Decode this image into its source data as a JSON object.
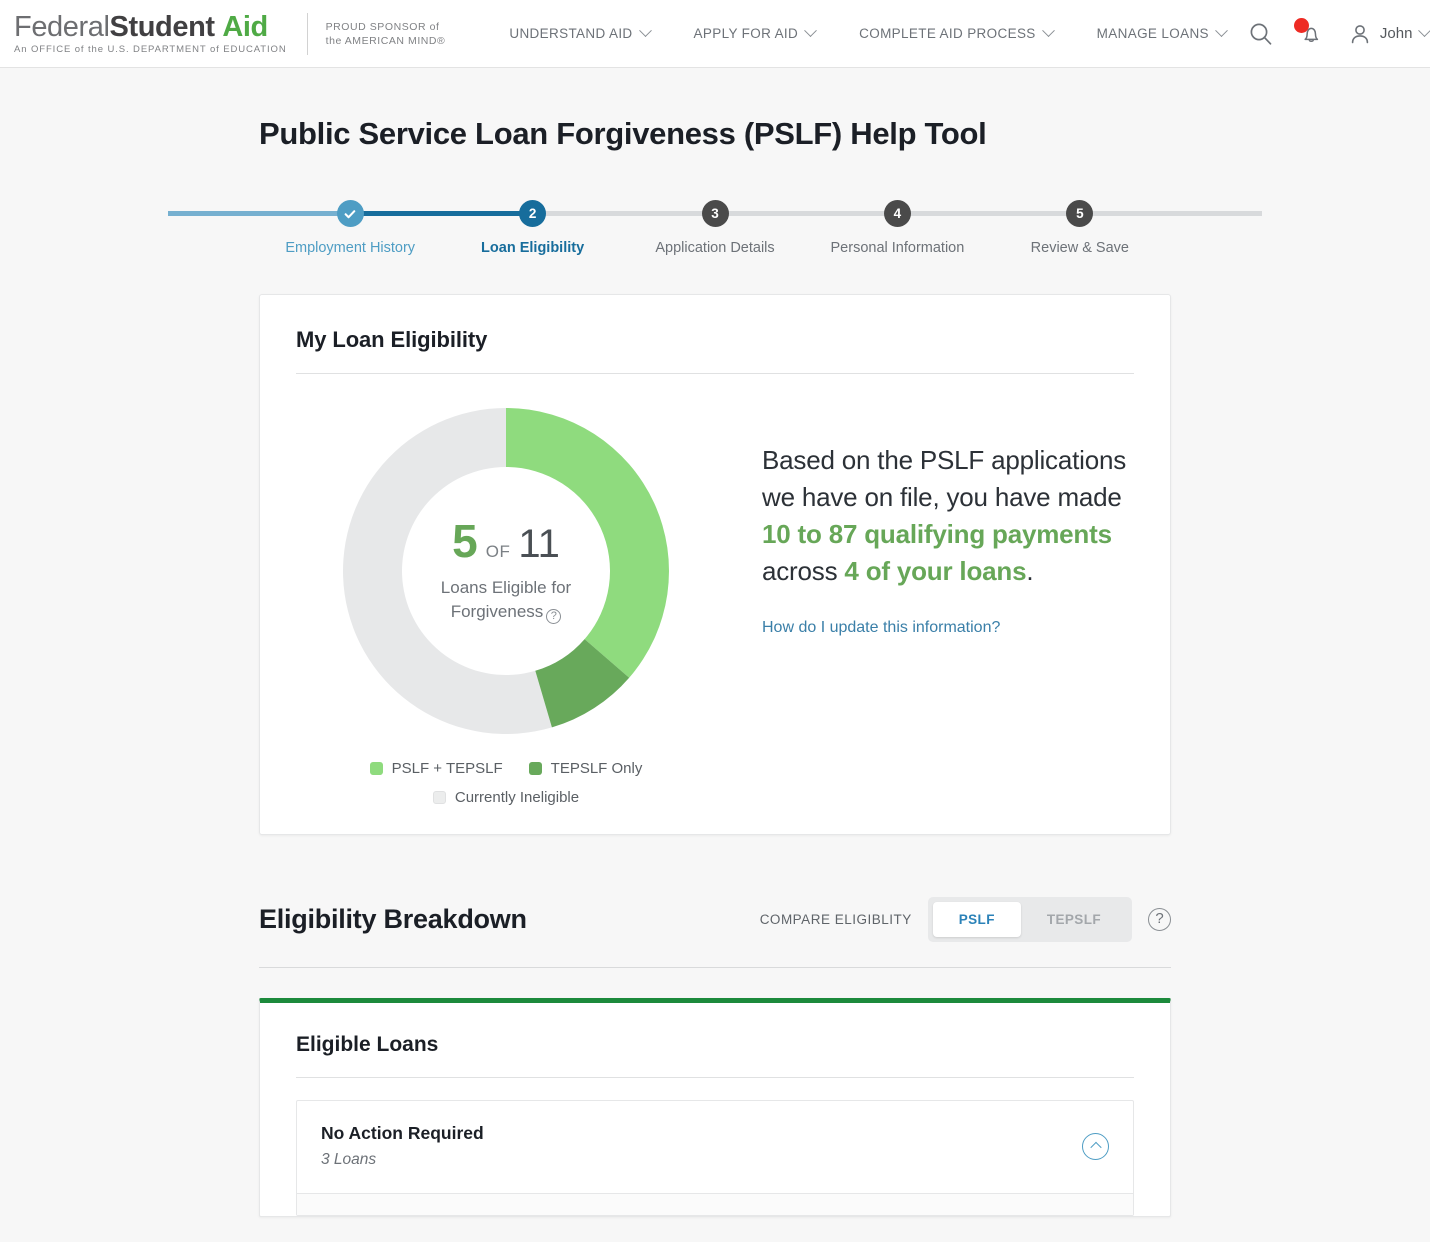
{
  "brand": {
    "line1_part1": "Federal",
    "line1_part2": "Student",
    "line1_part3": "Aid",
    "line2": "An OFFICE of the U.S. DEPARTMENT of EDUCATION",
    "tagline_line1": "PROUD SPONSOR of",
    "tagline_line2": "the AMERICAN MIND®"
  },
  "nav": {
    "items": [
      {
        "label": "UNDERSTAND AID"
      },
      {
        "label": "APPLY FOR AID"
      },
      {
        "label": "COMPLETE AID PROCESS"
      },
      {
        "label": "MANAGE LOANS"
      }
    ],
    "search_icon": "search-icon",
    "notification_icon": "bell-icon",
    "has_notification": true,
    "user_name": "John"
  },
  "page": {
    "title": "Public Service Loan Forgiveness (PSLF) Help Tool"
  },
  "stepper": {
    "steps": [
      {
        "num": "✓",
        "label": "Employment History",
        "state": "done"
      },
      {
        "num": "2",
        "label": "Loan Eligibility",
        "state": "current"
      },
      {
        "num": "3",
        "label": "Application Details",
        "state": "todo"
      },
      {
        "num": "4",
        "label": "Personal Information",
        "state": "todo"
      },
      {
        "num": "5",
        "label": "Review & Save",
        "state": "todo"
      }
    ]
  },
  "eligibility_card": {
    "title": "My Loan Eligibility",
    "center": {
      "numerator": "5",
      "of": "OF",
      "denominator": "11",
      "caption": "Loans Eligible for Forgiveness",
      "help_icon": "question-mark-icon"
    },
    "legend": [
      {
        "label": "PSLF + TEPSLF",
        "color": "#8fdb7e"
      },
      {
        "label": "TEPSLF Only",
        "color": "#68a95b"
      },
      {
        "label": "Currently Ineligible",
        "color": "#e7e8e9"
      }
    ],
    "statement": {
      "p1": "Based on the PSLF applications we have on file, you have made ",
      "h1": "10 to 87 qualifying payments",
      "p2": " across ",
      "h2": "4 of your loans",
      "p3": "."
    },
    "link": "How do I update this information?"
  },
  "chart_data": {
    "type": "pie",
    "title": "Loans Eligible for Forgiveness",
    "subtitle": "5 OF 11",
    "categories": [
      "PSLF + TEPSLF",
      "TEPSLF Only",
      "Currently Ineligible"
    ],
    "values": [
      4,
      1,
      6
    ],
    "colors": [
      "#8fdb7e",
      "#68a95b",
      "#e7e8e9"
    ],
    "total": 11,
    "eligible_total": 5,
    "unit": "loans",
    "legend_position": "bottom",
    "donut": true,
    "start_angle": 0
  },
  "breakdown": {
    "title": "Eligibility Breakdown",
    "compare_label": "COMPARE ELIGIBLITY",
    "toggle": [
      {
        "label": "PSLF",
        "active": true
      },
      {
        "label": "TEPSLF",
        "active": false
      }
    ],
    "help_icon": "question-mark-icon"
  },
  "eligible_loans": {
    "title": "Eligible Loans",
    "groups": [
      {
        "name": "No Action Required",
        "count": "3 Loans",
        "expanded": true
      }
    ]
  }
}
